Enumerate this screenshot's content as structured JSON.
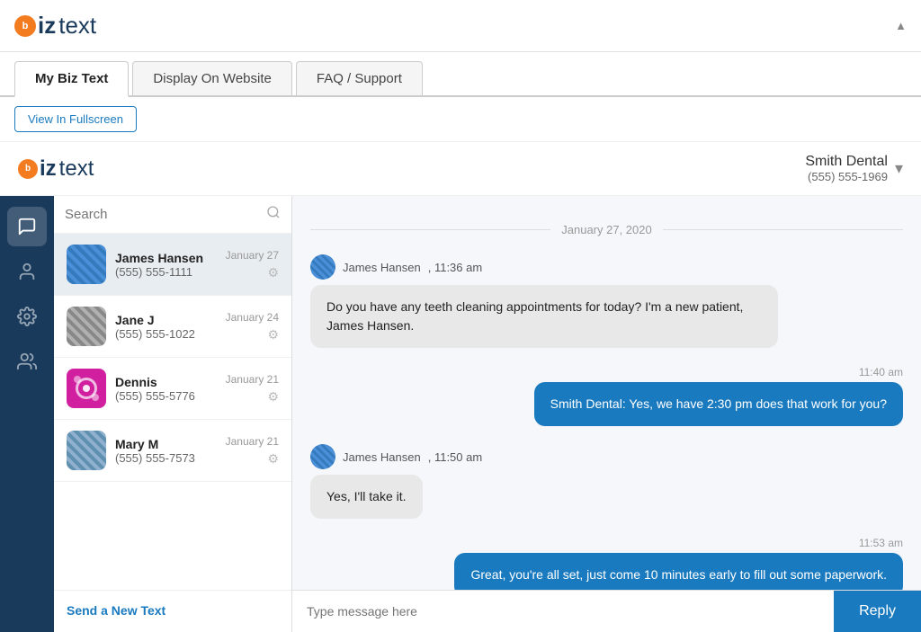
{
  "header": {
    "logo_b": "b",
    "logo_iz": "iz",
    "logo_text": "text",
    "scroll_up": "▲"
  },
  "tabs": [
    {
      "id": "my-biz-text",
      "label": "My Biz Text",
      "active": true
    },
    {
      "id": "display-on-website",
      "label": "Display On Website",
      "active": false
    },
    {
      "id": "faq-support",
      "label": "FAQ / Support",
      "active": false
    }
  ],
  "fullscreen": {
    "button_label": "View In Fullscreen"
  },
  "app_header": {
    "logo_text": "text",
    "practice_name": "Smith Dental",
    "practice_phone": "(555) 555-1969",
    "dropdown_arrow": "▾"
  },
  "search": {
    "placeholder": "Search"
  },
  "contacts": [
    {
      "name": "James Hansen",
      "phone": "(555) 555-1111",
      "date": "January 27",
      "avatar_class": "avatar-james",
      "selected": true
    },
    {
      "name": "Jane J",
      "phone": "(555) 555-1022",
      "date": "January 24",
      "avatar_class": "avatar-jane",
      "selected": false
    },
    {
      "name": "Dennis",
      "phone": "(555) 555-5776",
      "date": "January 21",
      "avatar_class": "avatar-dennis",
      "selected": false
    },
    {
      "name": "Mary M",
      "phone": "(555) 555-7573",
      "date": "January 21",
      "avatar_class": "avatar-mary",
      "selected": false
    }
  ],
  "send_new": {
    "label": "Send a New Text"
  },
  "chat": {
    "date_divider": "January 27, 2020",
    "messages": [
      {
        "type": "received",
        "sender": "James Hansen",
        "time": "11:36 am",
        "text": "Do you have any teeth cleaning appointments for today? I'm a new patient, James Hansen."
      },
      {
        "type": "sent",
        "time": "11:40 am",
        "text": "Smith Dental: Yes, we have 2:30 pm does that work for you?"
      },
      {
        "type": "received",
        "sender": "James Hansen",
        "time": "11:50 am",
        "text": "Yes, I'll take it."
      },
      {
        "type": "sent",
        "time": "11:53 am",
        "text": "Great, you're all set, just come 10 minutes early to fill out some paperwork."
      }
    ],
    "input_placeholder": "Type message here",
    "reply_button": "Reply"
  },
  "nav_items": [
    {
      "id": "chat",
      "icon": "💬",
      "active": true
    },
    {
      "id": "contacts",
      "icon": "👤",
      "active": false
    },
    {
      "id": "settings",
      "icon": "⚙",
      "active": false
    },
    {
      "id": "groups",
      "icon": "👥",
      "active": false
    }
  ]
}
